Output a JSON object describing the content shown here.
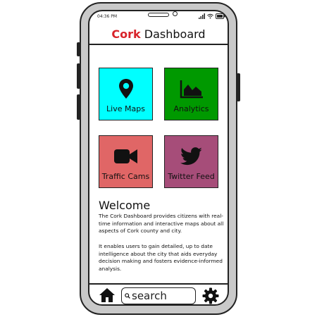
{
  "status_bar": {
    "time": "04:36 PM"
  },
  "header": {
    "brand": "Cork",
    "title": "Dashboard"
  },
  "tiles": [
    {
      "label": "Live Maps",
      "icon": "map-pin-icon",
      "color": "#00ffff"
    },
    {
      "label": "Analytics",
      "icon": "area-chart-icon",
      "color": "#009900"
    },
    {
      "label": "Traffic Cams",
      "icon": "video-camera-icon",
      "color": "#e06666"
    },
    {
      "label": "Twitter Feed",
      "icon": "twitter-bird-icon",
      "color": "#a64d79"
    }
  ],
  "welcome": {
    "title": "Welcome",
    "paragraph1": "The Cork Dashboard provides citizens with real-time information and interactive maps about all aspects of Cork county and city.",
    "paragraph2": "It enables users to gain detailed, up to date intelligence about the city that aids everyday decision making and fosters evidence-informed analysis."
  },
  "bottom_bar": {
    "search_placeholder": "search",
    "home_icon": "home-icon",
    "settings_icon": "gear-icon"
  },
  "colors": {
    "brand_red": "#d8232a",
    "phone_frame": "#c9c9c9"
  }
}
